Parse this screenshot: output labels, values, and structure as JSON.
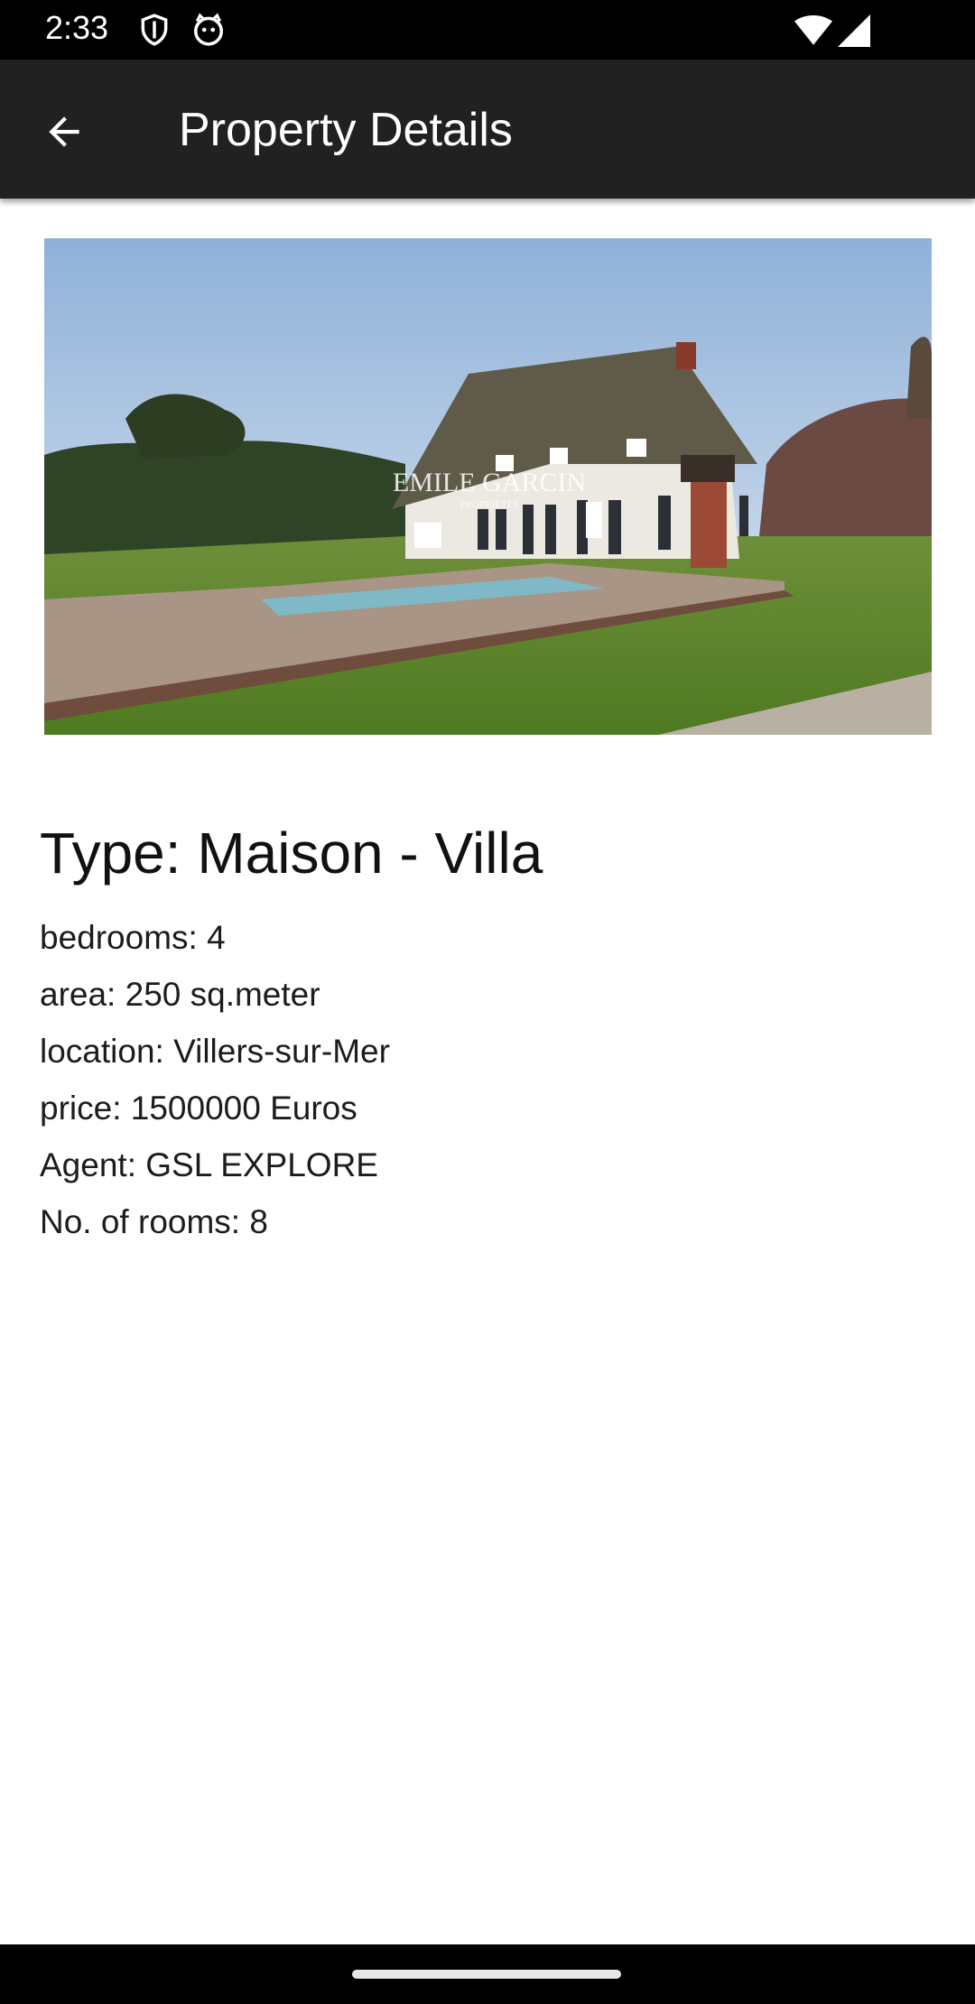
{
  "status_bar": {
    "time": "2:33",
    "icons": [
      "shield-icon",
      "cat-face-icon",
      "wifi-icon",
      "cellular-signal-icon"
    ]
  },
  "app_bar": {
    "back_icon": "arrow-back-icon",
    "title": "Property Details"
  },
  "property": {
    "image_watermark": "EMILE GARCIN",
    "image_watermark_sub": "PROPRIÉTÉS",
    "type": "Type: Maison - Villa",
    "bedrooms": "bedrooms: 4",
    "area": "area: 250 sq.meter",
    "location": "location: Villers-sur-Mer",
    "price": "price: 1500000 Euros",
    "agent": "Agent: GSL EXPLORE",
    "rooms": "No. of rooms: 8"
  },
  "colors": {
    "app_bar": "#212121",
    "status_bar": "#000000",
    "background": "#ffffff"
  }
}
